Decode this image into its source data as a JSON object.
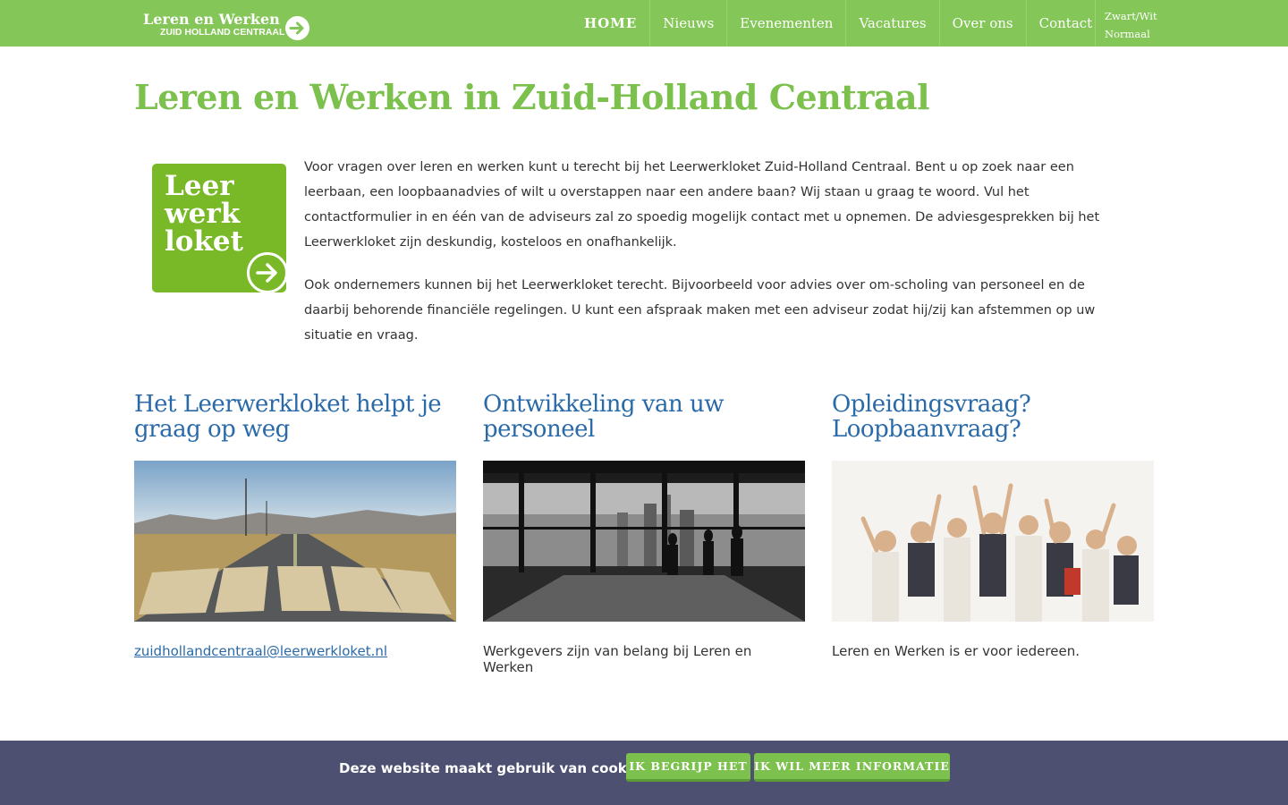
{
  "header": {
    "logo_line1": "Leren en Werken",
    "logo_line2": "ZUID HOLLAND CENTRAAL",
    "nav": [
      "HOME",
      "Nieuws",
      "Evenementen",
      "Vacatures",
      "Over ons",
      "Contact"
    ],
    "contrast": [
      "Zwart/Wit",
      "Normaal"
    ]
  },
  "main": {
    "title": "Leren en Werken in Zuid-Holland Centraal",
    "loket_logo": [
      "Leer",
      "werk",
      "loket"
    ],
    "paragraphs": [
      "Voor vragen over leren en werken kunt u terecht bij het Leerwerkloket Zuid-Holland Centraal. Bent u op zoek naar een leerbaan, een loopbaanadvies of wilt u overstappen naar een andere baan? Wij staan u graag te woord. Vul het contactformulier in en één van de adviseurs zal zo spoedig mogelijk contact met u opnemen. De adviesgesprekken bij het Leerwerkloket zijn deskundig, kosteloos en onafhankelijk.",
      "Ook ondernemers kunnen bij het Leerwerkloket terecht. Bijvoorbeeld voor advies over om-scholing van personeel en de daarbij behorende financiële regelingen. U kunt een afspraak maken met een adviseur zodat hij/zij kan afstemmen op uw situatie en vraag."
    ]
  },
  "cards": [
    {
      "title": "Het Leerwerkloket helpt je graag op weg",
      "image": "road-start-photo",
      "caption": "zuidhollandcentraal@leerwerkloket.nl"
    },
    {
      "title": "Ontwikkeling van uw personeel",
      "image": "office-skyline-photo",
      "caption": "Werkgevers zijn van belang bij Leren en Werken"
    },
    {
      "title": "Opleidingsvraag? Loopbaanvraag?",
      "image": "cheering-group-photo",
      "caption": "Leren en Werken is er voor iedereen."
    }
  ],
  "cookie": {
    "text": "Deze website maakt gebruik van cookies",
    "accept": "IK BEGRIJP HET",
    "more": "IK WIL MEER INFORMATIE"
  },
  "colors": {
    "brand_green": "#84c658",
    "title_green": "#7cc04d",
    "heading_blue": "#2a6aa8",
    "cookie_bg": "#4d5070"
  }
}
